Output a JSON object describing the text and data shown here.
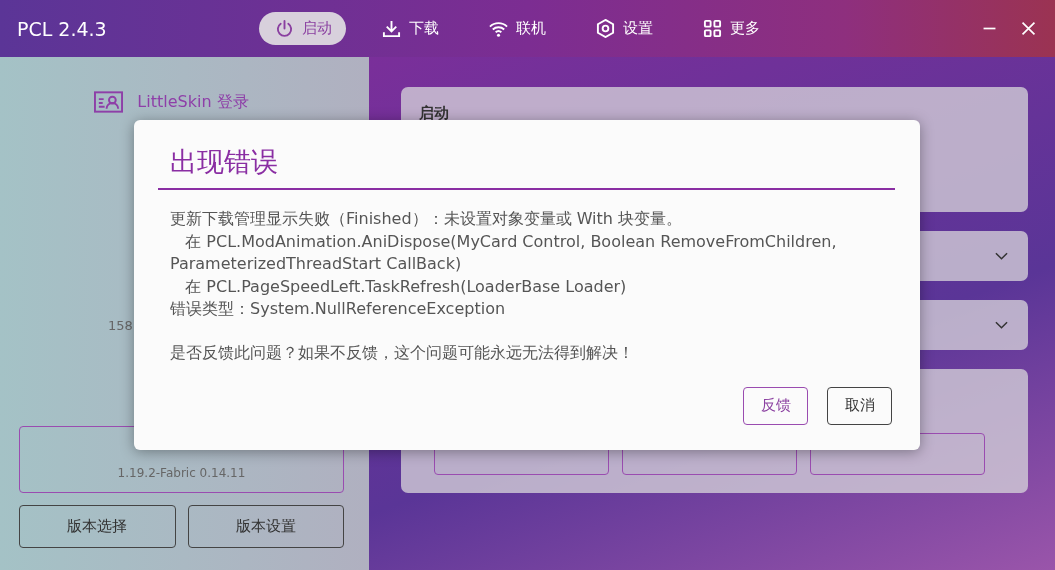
{
  "window": {
    "title": "PCL 2.4.3"
  },
  "nav": [
    {
      "label": "启动",
      "selected": true
    },
    {
      "label": "下载",
      "selected": false
    },
    {
      "label": "联机",
      "selected": false
    },
    {
      "label": "设置",
      "selected": false
    },
    {
      "label": "更多",
      "selected": false
    }
  ],
  "sidebar": {
    "login": "LittleSkin 登录",
    "info": "158",
    "launch": {
      "version": "1.19.2-Fabric 0.14.11"
    },
    "buttons": [
      "版本选择",
      "版本设置"
    ]
  },
  "main": {
    "launch_card": {
      "title": "启动"
    }
  },
  "dialog": {
    "title": "出现错误",
    "lines": [
      "更新下载管理显示失败（Finished）：未设置对象变量或 With 块变量。",
      "   在 PCL.ModAnimation.AniDispose(MyCard Control, Boolean RemoveFromChildren, ParameterizedThreadStart CallBack)",
      "   在 PCL.PageSpeedLeft.TaskRefresh(LoaderBase Loader)",
      "错误类型：System.NullReferenceException"
    ],
    "question": "是否反馈此问题？如果不反馈，这个问题可能永远无法得到解决！",
    "buttons": [
      {
        "label": "反馈",
        "primary": true
      },
      {
        "label": "取消",
        "primary": false
      }
    ]
  }
}
